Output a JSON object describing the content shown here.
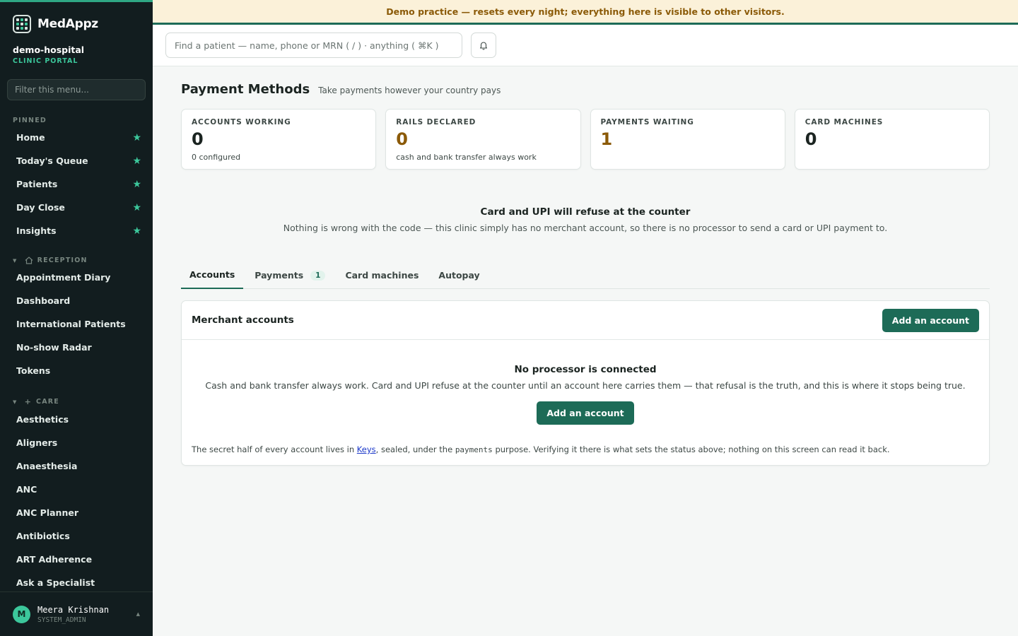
{
  "brand": {
    "name": "MedAppz"
  },
  "org": {
    "name": "demo-hospital",
    "subtitle": "CLINIC PORTAL"
  },
  "sidebar": {
    "filter_placeholder": "Filter this menu...",
    "pinned_label": "PINNED",
    "pinned": [
      {
        "label": "Home"
      },
      {
        "label": "Today's Queue"
      },
      {
        "label": "Patients"
      },
      {
        "label": "Day Close"
      },
      {
        "label": "Insights"
      }
    ],
    "reception_label": "RECEPTION",
    "reception": [
      {
        "label": "Appointment Diary"
      },
      {
        "label": "Dashboard"
      },
      {
        "label": "International Patients"
      },
      {
        "label": "No-show Radar"
      },
      {
        "label": "Tokens"
      }
    ],
    "care_label": "CARE",
    "care": [
      {
        "label": "Aesthetics"
      },
      {
        "label": "Aligners"
      },
      {
        "label": "Anaesthesia"
      },
      {
        "label": "ANC"
      },
      {
        "label": "ANC Planner"
      },
      {
        "label": "Antibiotics"
      },
      {
        "label": "ART Adherence"
      },
      {
        "label": "Ask a Specialist"
      }
    ]
  },
  "user": {
    "initial": "M",
    "name": "Meera Krishnan",
    "role": "SYSTEM_ADMIN"
  },
  "banner": {
    "text": "Demo practice — resets every night; everything here is visible to other visitors."
  },
  "search": {
    "placeholder": "Find a patient — name, phone or MRN ( / ) · anything ( ⌘K )"
  },
  "page": {
    "title": "Payment Methods",
    "subtitle": "Take payments however your country pays"
  },
  "stats": [
    {
      "label": "ACCOUNTS WORKING",
      "value": "0",
      "note": "0 configured"
    },
    {
      "label": "RAILS DECLARED",
      "value": "0",
      "note": "cash and bank transfer always work"
    },
    {
      "label": "PAYMENTS WAITING",
      "value": "1",
      "note": ""
    },
    {
      "label": "CARD MACHINES",
      "value": "0",
      "note": ""
    }
  ],
  "alert": {
    "title": "Card and UPI will refuse at the counter",
    "body": "Nothing is wrong with the code — this clinic simply has no merchant account, so there is no processor to send a card or UPI payment to."
  },
  "tabs": [
    {
      "label": "Accounts"
    },
    {
      "label": "Payments",
      "badge": "1"
    },
    {
      "label": "Card machines"
    },
    {
      "label": "Autopay"
    }
  ],
  "panel": {
    "title": "Merchant accounts",
    "add_label": "Add an account",
    "empty_title": "No processor is connected",
    "empty_body": "Cash and bank transfer always work. Card and UPI refuse at the counter until an account here carries them — that refusal is the truth, and this is where it stops being true.",
    "empty_button": "Add an account",
    "footnote_pre": "The secret half of every account lives in ",
    "footnote_link": "Keys",
    "footnote_mid": ", sealed, under the ",
    "footnote_code": "payments",
    "footnote_post": " purpose. Verifying it there is what sets the status above; nothing on this screen can read it back."
  },
  "colors": {
    "accent": "#1d6b57",
    "brand_green": "#3cc79b",
    "sidebar_bg": "#121d1f",
    "warning": "#8b5a08"
  }
}
